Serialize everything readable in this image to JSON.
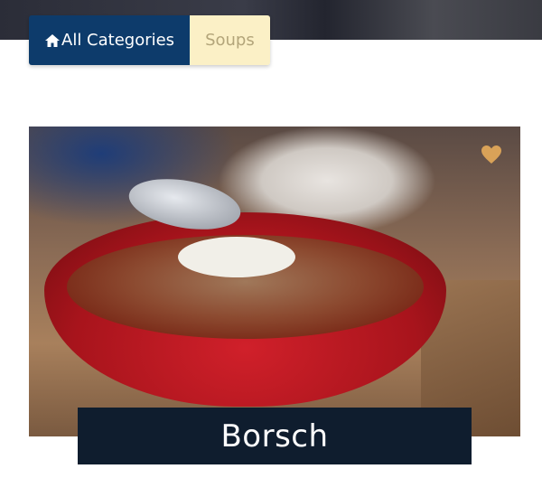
{
  "breadcrumb": {
    "home_label": "All Categories",
    "home_icon": "home-icon",
    "current_label": "Soups"
  },
  "recipe": {
    "title": "Borsch",
    "favorite_icon": "heart-icon",
    "favorite_color": "#d9a258"
  },
  "colors": {
    "breadcrumb_home_bg": "#0d3b6b",
    "breadcrumb_current_bg": "#fbf0c6",
    "title_bg": "#0f1d2e"
  }
}
